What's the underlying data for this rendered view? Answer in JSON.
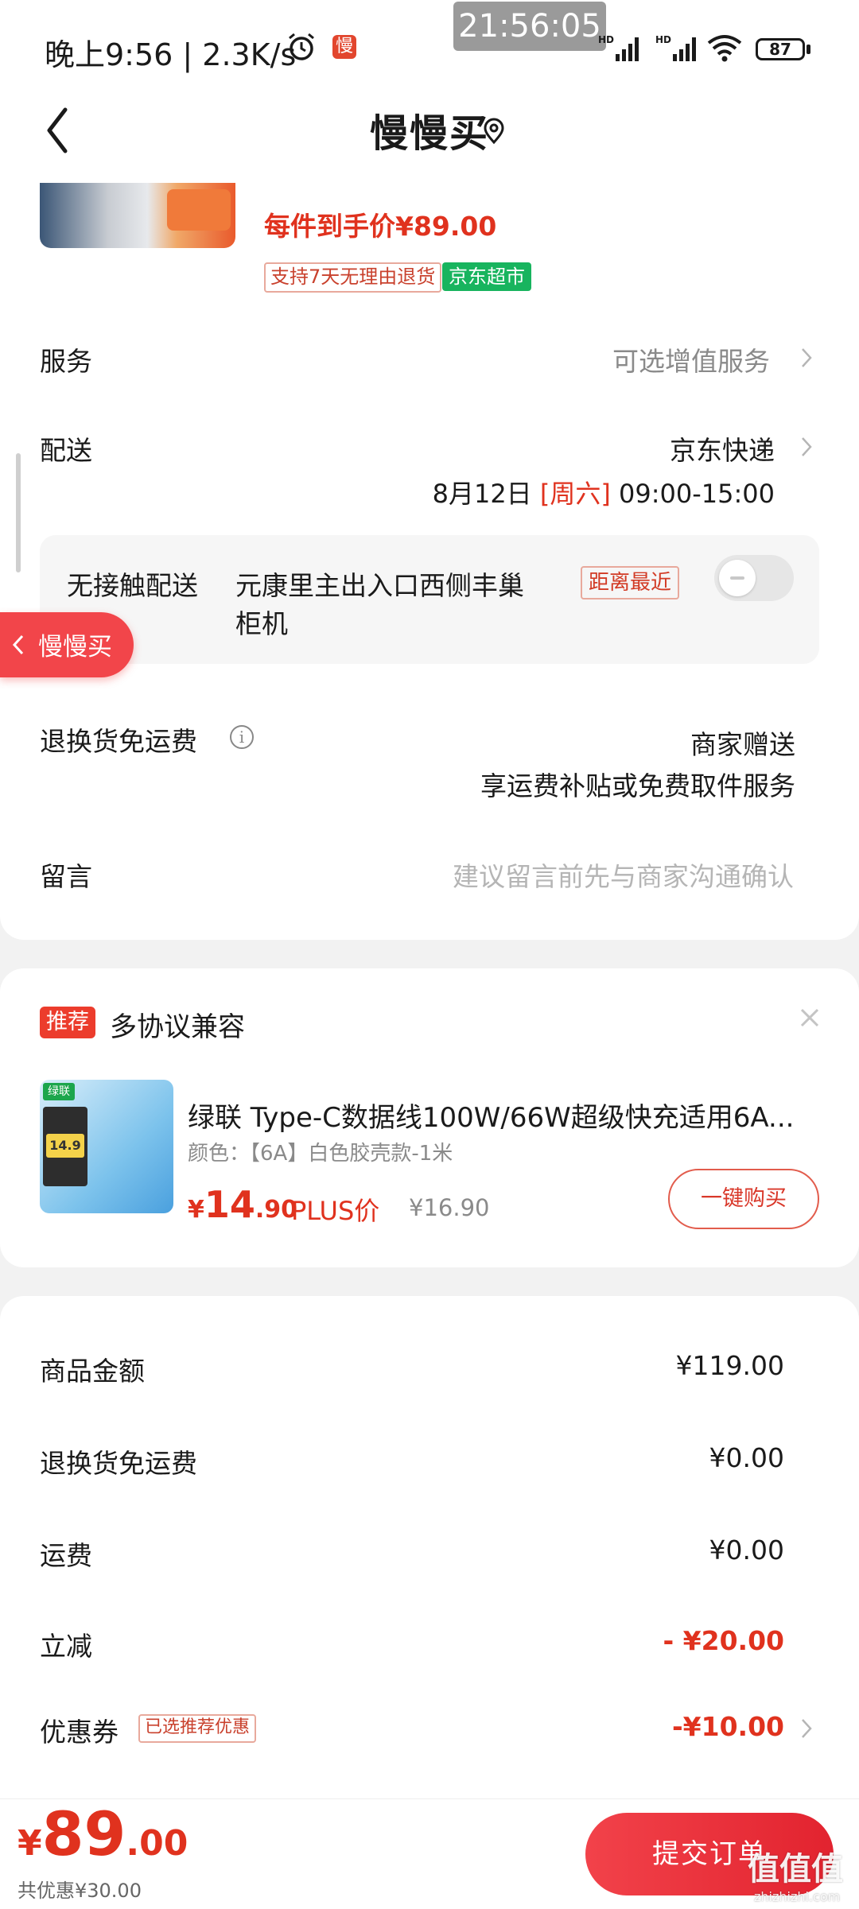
{
  "status_bar": {
    "time_speed": "晚上9:56 | 2.3K/s",
    "app_badge": "慢",
    "clock_overlay": "21:56:05",
    "battery": "87",
    "signal_label": "HD"
  },
  "nav": {
    "title": "慢慢买"
  },
  "order_item": {
    "price_each": "每件到手价¥89.00",
    "tag_return": "支持7天无理由退货",
    "tag_store": "京东超市"
  },
  "service": {
    "label": "服务",
    "value": "可选增值服务"
  },
  "delivery": {
    "label": "配送",
    "carrier": "京东快递",
    "date": "8月12日",
    "weekday": "[周六]",
    "time_range": "09:00-15:00",
    "contactless_label": "无接触配送",
    "location_line1": "元康里主出入口西侧丰巢",
    "location_line2": "柜机",
    "nearest_tag": "距离最近"
  },
  "floating_button": {
    "label": "慢慢买"
  },
  "return_shipping": {
    "label": "退换货免运费",
    "value_line1": "商家赠送",
    "value_line2": "享运费补贴或免费取件服务"
  },
  "message": {
    "label": "留言",
    "placeholder": "建议留言前先与商家沟通确认"
  },
  "recommendation": {
    "badge": "推荐",
    "title": "多协议兼容",
    "thumb_brand": "绿联",
    "thumb_price": "14.9",
    "name": "绿联 Type-C数据线100W/66W超级快充适用6A...",
    "variant": "颜色：【6A】白色胶壳款-1米",
    "price_yen": "¥",
    "price_int": "14",
    "price_dec": ".90",
    "plus_label": "PLUS价",
    "original_price": "¥16.90",
    "buy_button": "一键购买"
  },
  "summary": {
    "rows": [
      {
        "label": "商品金额",
        "value": "¥119.00"
      },
      {
        "label": "退换货免运费",
        "value": "¥0.00"
      },
      {
        "label": "运费",
        "value": "¥0.00"
      },
      {
        "label": "立减",
        "value": "- ¥20.00"
      },
      {
        "label": "优惠券",
        "value": "-¥10.00",
        "tag": "已选推荐优惠"
      }
    ]
  },
  "footer": {
    "total_yen": "¥",
    "total_int": "89",
    "total_dec": ".00",
    "saved": "共优惠¥30.00",
    "submit": "提交订单",
    "watermark": "值值值",
    "watermark_url": "zhizhizhi.com"
  },
  "colors": {
    "accent_red": "#e0321e",
    "jd_green": "#18b45e",
    "submit_red": "#e2232f"
  }
}
